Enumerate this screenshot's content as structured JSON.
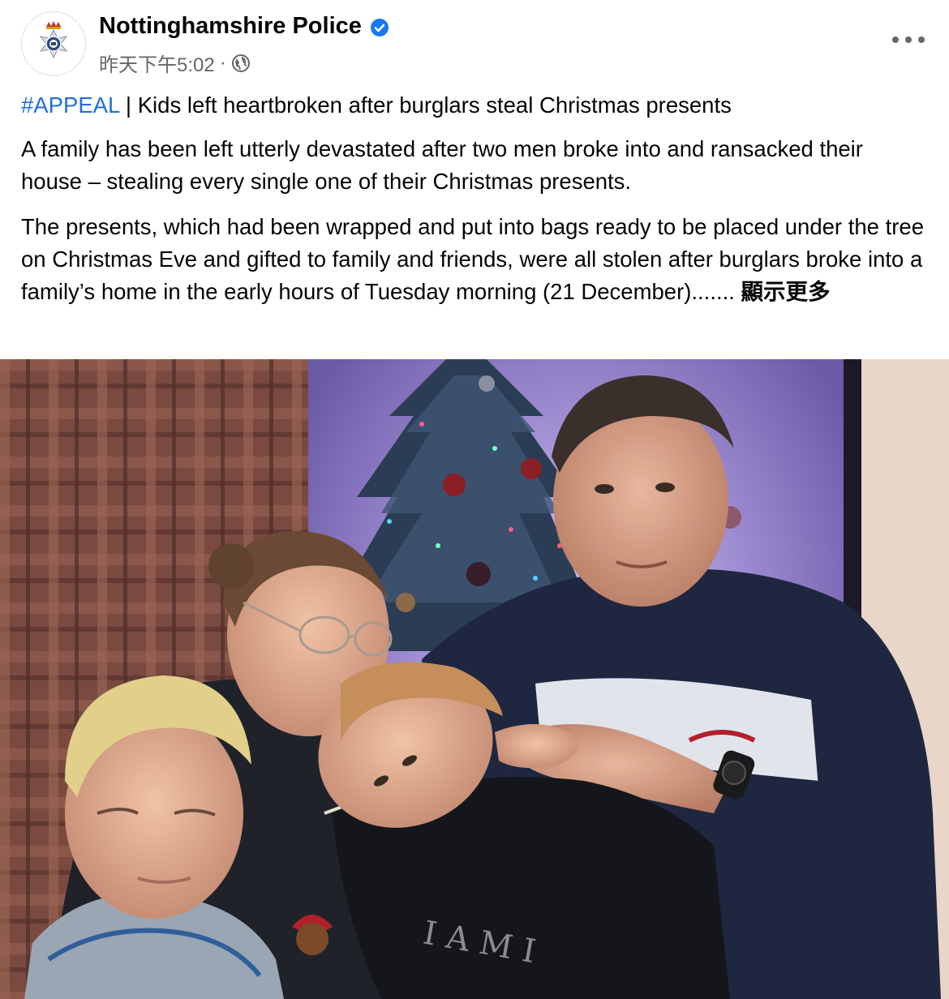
{
  "post": {
    "page_name": "Nottinghamshire Police",
    "timestamp": "昨天下午5:02",
    "separator": "·",
    "privacy_icon": "globe-icon",
    "verified_icon": "verified-badge-icon",
    "more_icon": "more-options-icon",
    "hashtag": "#APPEAL",
    "headline": " | Kids left heartbroken after burglars steal Christmas presents",
    "paragraph1": "A family has been left utterly devastated after two men broke into and ransacked their house – stealing every single one of their Christmas presents.",
    "paragraph2": "The presents, which had been wrapped and put into bags ready to be placed under the tree on Christmas Eve and gifted to family and friends, were all stolen after burglars broke into a family’s home in the early hours of Tuesday morning (21 December).......",
    "see_more": " 顯示更多"
  },
  "colors": {
    "link": "#216fdb",
    "secondary_text": "#65676b",
    "verified": "#1877f2"
  }
}
